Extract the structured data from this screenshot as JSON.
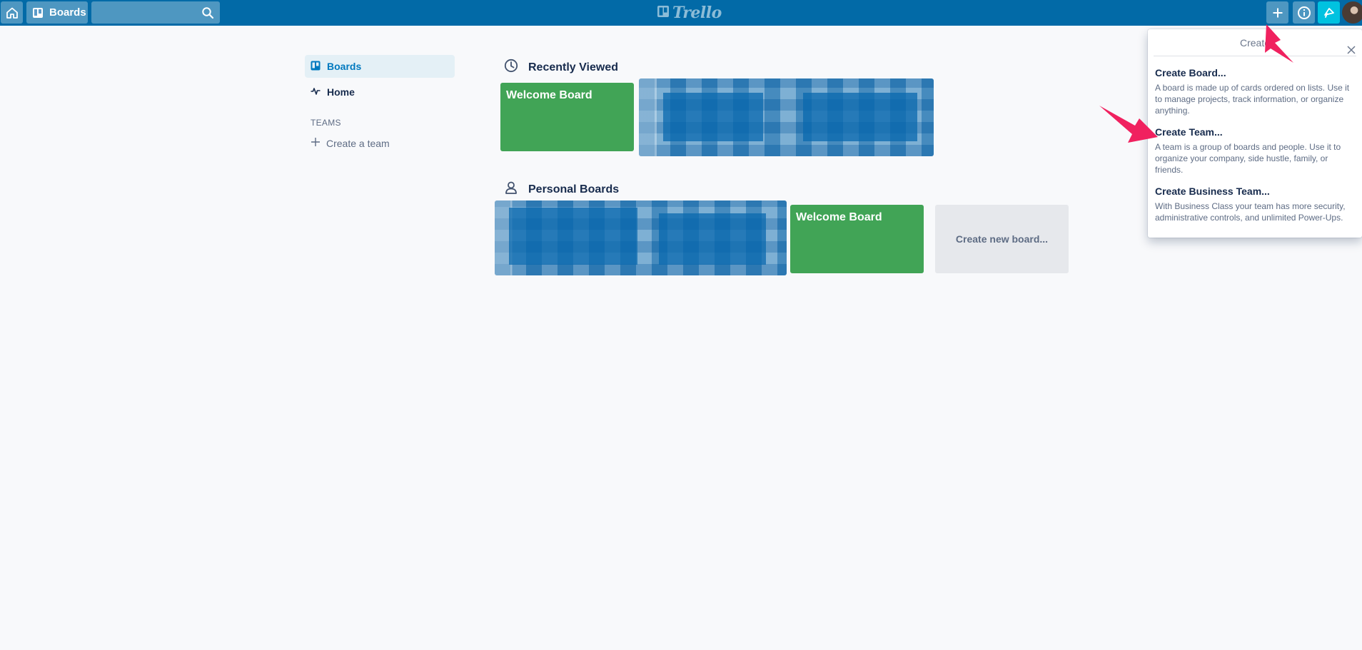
{
  "header": {
    "boards_label": "Boards",
    "search_placeholder": "",
    "logo_text": "Trello"
  },
  "sidebar": {
    "items": [
      {
        "label": "Boards",
        "icon": "board-icon",
        "active": true
      },
      {
        "label": "Home",
        "icon": "activity-icon",
        "active": false
      }
    ],
    "teams_label": "TEAMS",
    "create_team_label": "Create a team"
  },
  "main": {
    "recently_viewed": {
      "title": "Recently Viewed",
      "boards": [
        {
          "title": "Welcome Board",
          "color": "#41a456"
        }
      ]
    },
    "personal_boards": {
      "title": "Personal Boards",
      "boards": [
        {
          "title": "Welcome Board",
          "color": "#41a456"
        }
      ],
      "create_new_label": "Create new board..."
    }
  },
  "popover": {
    "title": "Create",
    "items": [
      {
        "title": "Create Board...",
        "description": "A board is made up of cards ordered on lists. Use it to manage projects, track information, or organize anything."
      },
      {
        "title": "Create Team...",
        "description": "A team is a group of boards and people. Use it to organize your company, side hustle, family, or friends."
      },
      {
        "title": "Create Business Team...",
        "description": "With Business Class your team has more security, administrative controls, and unlimited Power-Ups."
      }
    ]
  },
  "colors": {
    "header": "#026aa7",
    "board_green": "#41a456",
    "annotation_arrow": "#f0215f"
  }
}
